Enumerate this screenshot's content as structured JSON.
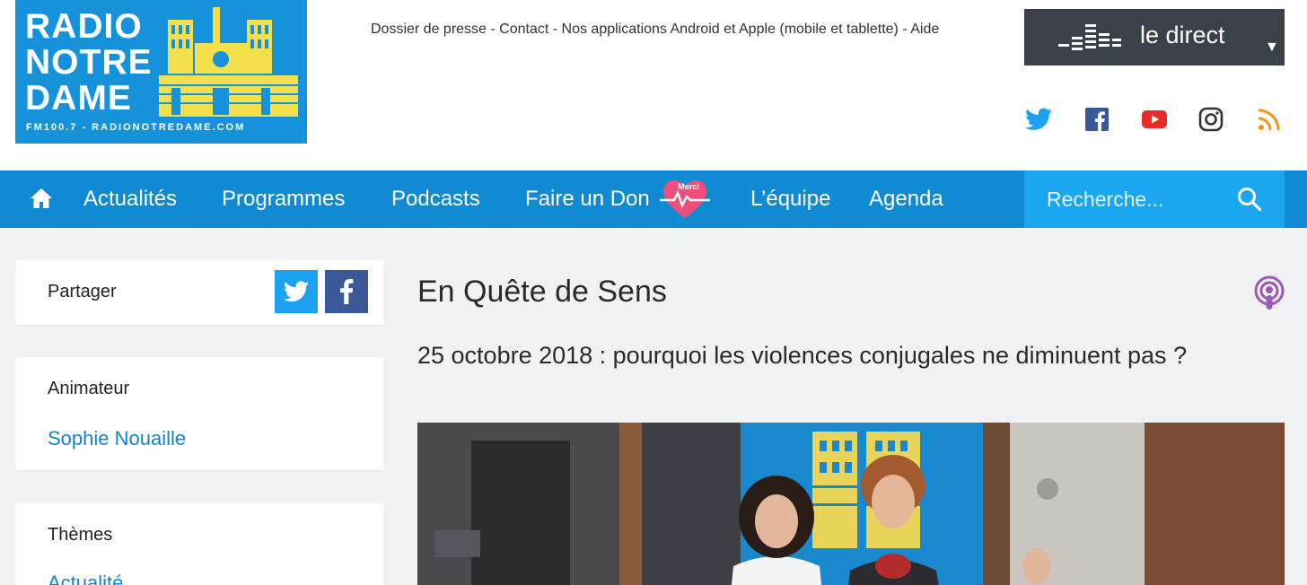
{
  "logo": {
    "lines": [
      "RADIO",
      "NOTRE",
      "DAME"
    ],
    "subline": "FM100.7 - RADIONOTREDAME.COM",
    "colors": {
      "background": "#1592da",
      "building": "#f4e04d"
    }
  },
  "toplinks": {
    "items": [
      "Dossier de presse",
      "Contact",
      "Nos applications Android et Apple (mobile et tablette)",
      "Aide"
    ],
    "separator": " - "
  },
  "live": {
    "label": "le direct",
    "arrow": "▼",
    "icon": "equalizer-icon"
  },
  "social": [
    {
      "name": "twitter-icon",
      "color": "#1da1f2"
    },
    {
      "name": "facebook-icon",
      "color": "#3b5998"
    },
    {
      "name": "youtube-icon",
      "color": "#e52d27"
    },
    {
      "name": "instagram-icon",
      "color": "#333333"
    },
    {
      "name": "rss-icon",
      "color": "#f7931e"
    }
  ],
  "nav": {
    "home_icon": "home-icon",
    "items": [
      "Actualités",
      "Programmes",
      "Podcasts",
      "Faire un Don",
      "L’équipe",
      "Agenda"
    ],
    "don_badge": "Merci",
    "search_placeholder": "Recherche...",
    "search_icon": "search-icon",
    "colors": {
      "bar": "#0f8ad3",
      "search": "#1ba6f2"
    }
  },
  "sidebar": {
    "share": {
      "label": "Partager",
      "buttons": [
        "twitter-icon",
        "facebook-icon"
      ]
    },
    "animator": {
      "heading": "Animateur",
      "name": "Sophie Nouaille"
    },
    "themes": {
      "heading": "Thèmes",
      "first_item": "Actualité"
    }
  },
  "main": {
    "title": "En Quête de Sens",
    "subtitle": "25 octobre 2018 : pourquoi les violences conjugales ne diminuent pas ?",
    "podcast_icon": "podcast-icon",
    "photo_label": "studio-photo"
  }
}
